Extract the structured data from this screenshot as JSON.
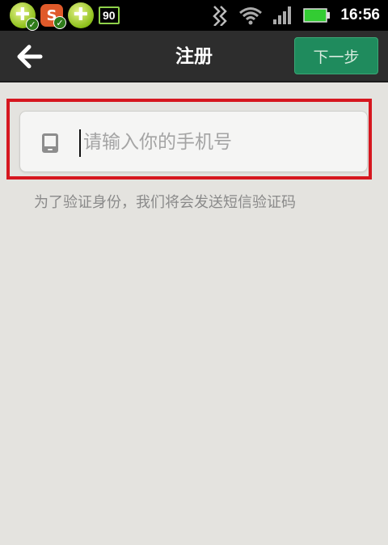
{
  "status_bar": {
    "notifications": [
      {
        "icon": "plus-shield-icon",
        "accent": "#8cbf1a"
      },
      {
        "icon": "sogou-input-icon",
        "label": "S",
        "accent": "#e05a2a"
      },
      {
        "icon": "plus-shield-icon",
        "accent": "#8cbf1a"
      }
    ],
    "badge": "90",
    "time": "16:56",
    "battery_color": "#33cc33"
  },
  "titlebar": {
    "title": "注册",
    "next_label": "下一步",
    "next_color": "#1f8b5d"
  },
  "form": {
    "phone_placeholder": "请输入你的手机号",
    "phone_value": "",
    "hint": "为了验证身份，我们将会发送短信验证码"
  },
  "highlight_color": "#d6171f"
}
